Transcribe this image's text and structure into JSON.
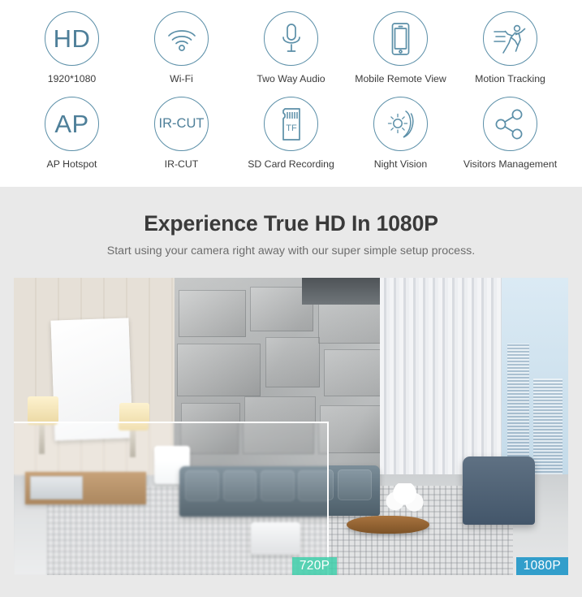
{
  "features": {
    "row1": [
      {
        "icon": "hd-icon",
        "icon_text": "HD",
        "label": "1920*1080"
      },
      {
        "icon": "wifi-icon",
        "icon_text": "",
        "label": "Wi-Fi"
      },
      {
        "icon": "microphone-icon",
        "icon_text": "",
        "label": "Two Way Audio"
      },
      {
        "icon": "mobile-phone-icon",
        "icon_text": "",
        "label": "Mobile Remote View"
      },
      {
        "icon": "motion-running-icon",
        "icon_text": "",
        "label": "Motion Tracking"
      }
    ],
    "row2": [
      {
        "icon": "ap-icon",
        "icon_text": "AP",
        "label": "AP Hotspot"
      },
      {
        "icon": "ir-cut-icon",
        "icon_text": "IR-CUT",
        "label": "IR-CUT"
      },
      {
        "icon": "sd-card-icon",
        "icon_text": "TF",
        "label": "SD Card Recording"
      },
      {
        "icon": "night-vision-icon",
        "icon_text": "",
        "label": "Night Vision"
      },
      {
        "icon": "share-network-icon",
        "icon_text": "",
        "label": "Visitors Management"
      }
    ]
  },
  "promo": {
    "title": "Experience True HD In 1080P",
    "subtitle": "Start using your camera right away with our super simple setup process."
  },
  "comparison": {
    "badge_low": "720P",
    "badge_high": "1080P"
  },
  "colors": {
    "icon_stroke": "#5b8fa8",
    "icon_text": "#4e7f99",
    "label_text": "#3b3b3b",
    "promo_background": "#e9e9e9",
    "promo_title": "#3a3a3a",
    "promo_subtitle": "#6d6d6d",
    "badge_low": "#39cea8",
    "badge_high": "#1e96c8"
  }
}
